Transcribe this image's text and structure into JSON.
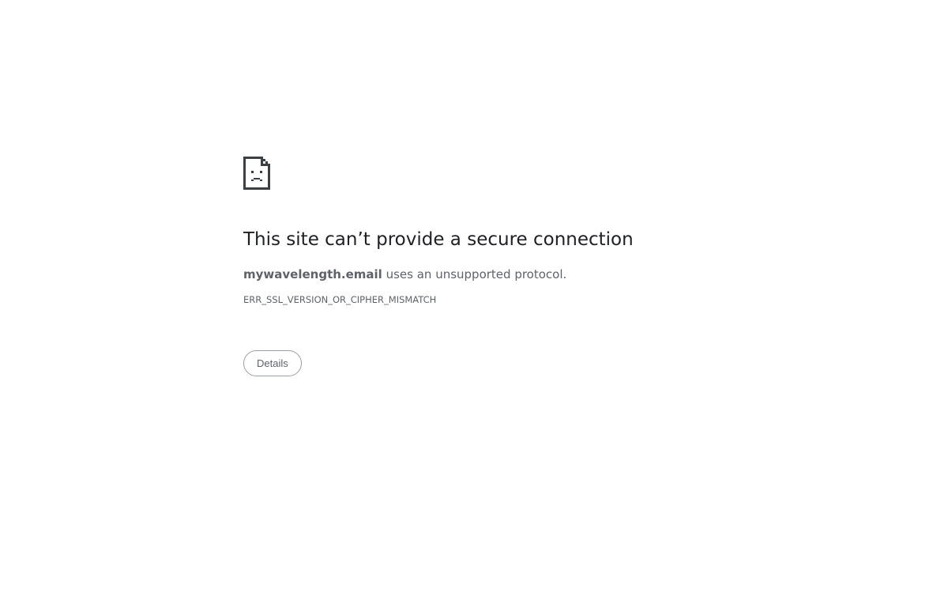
{
  "error": {
    "icon": "sad-page-icon",
    "heading": "This site can’t provide a secure connection",
    "host": "mywavelength.email",
    "summary_rest": " uses an unsupported protocol.",
    "code": "ERR_SSL_VERSION_OR_CIPHER_MISMATCH",
    "details_label": "Details"
  },
  "colors": {
    "heading": "#202124",
    "text": "#5f6368",
    "button_border": "#9aa0a6",
    "background": "#ffffff"
  }
}
